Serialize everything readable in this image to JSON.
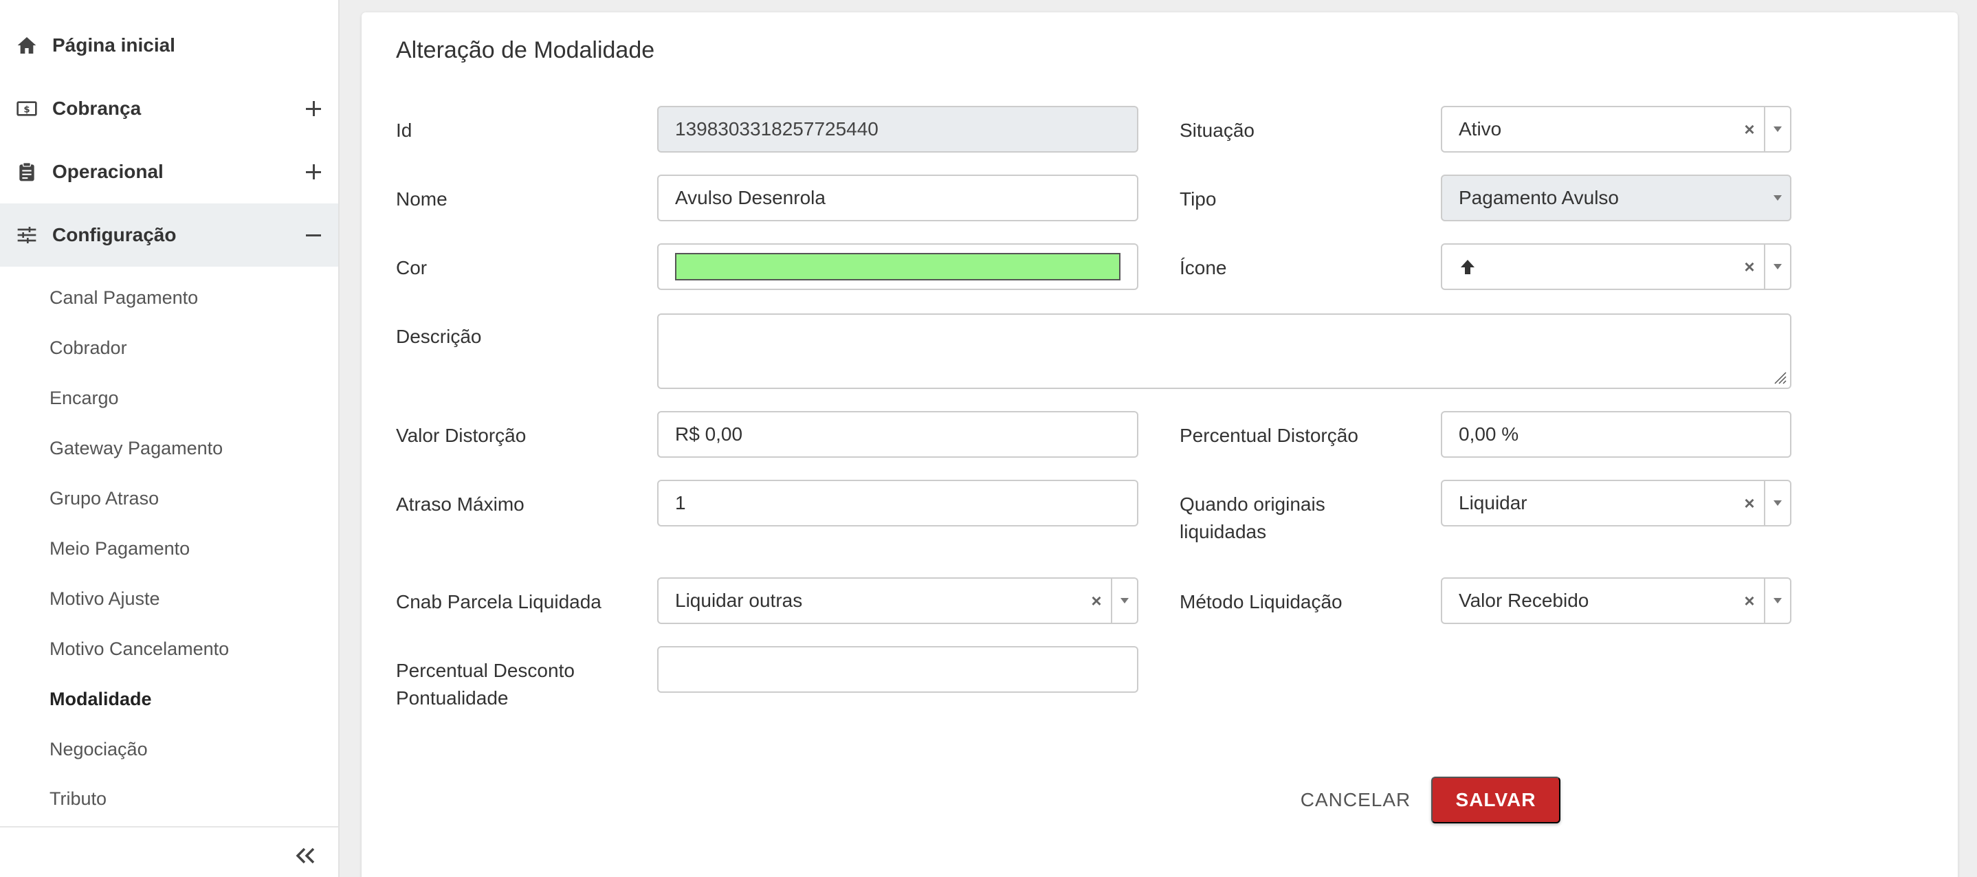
{
  "sidebar": {
    "items": [
      {
        "label": "Página inicial",
        "icon": "home-icon"
      },
      {
        "label": "Cobrança",
        "icon": "money-icon"
      },
      {
        "label": "Operacional",
        "icon": "clipboard-icon"
      },
      {
        "label": "Configuração",
        "icon": "sliders-icon"
      }
    ],
    "submenu": [
      "Canal Pagamento",
      "Cobrador",
      "Encargo",
      "Gateway Pagamento",
      "Grupo Atraso",
      "Meio Pagamento",
      "Motivo Ajuste",
      "Motivo Cancelamento",
      "Modalidade",
      "Negociação",
      "Tributo"
    ]
  },
  "form": {
    "title": "Alteração de Modalidade",
    "id_label": "Id",
    "id_value": "1398303318257725440",
    "situacao_label": "Situação",
    "situacao_value": "Ativo",
    "nome_label": "Nome",
    "nome_value": "Avulso Desenrola",
    "tipo_label": "Tipo",
    "tipo_value": "Pagamento Avulso",
    "cor_label": "Cor",
    "cor_value": "#99f48a",
    "icone_label": "Ícone",
    "icone_value": "arrow-up-icon",
    "descricao_label": "Descrição",
    "valor_distorcao_label": "Valor Distorção",
    "valor_distorcao_value": "R$ 0,00",
    "percentual_distorcao_label": "Percentual Distorção",
    "percentual_distorcao_value": "0,00 %",
    "atraso_maximo_label": "Atraso Máximo",
    "atraso_maximo_value": "1",
    "quando_originais_label_1": "Quando originais",
    "quando_originais_label_2": "liquidadas",
    "quando_originais_value": "Liquidar",
    "cnab_label": "Cnab Parcela Liquidada",
    "cnab_value": "Liquidar outras",
    "metodo_label": "Método Liquidação",
    "metodo_value": "Valor Recebido",
    "percentual_desconto_label_1": "Percentual Desconto",
    "percentual_desconto_label_2": "Pontualidade",
    "percentual_desconto_value": "",
    "clear_symbol": "×"
  },
  "actions": {
    "cancel_label": "CANCELAR",
    "save_label": "SALVAR"
  },
  "colors": {
    "save_button": "#c62828",
    "active_nav_bg": "#eceff1"
  }
}
